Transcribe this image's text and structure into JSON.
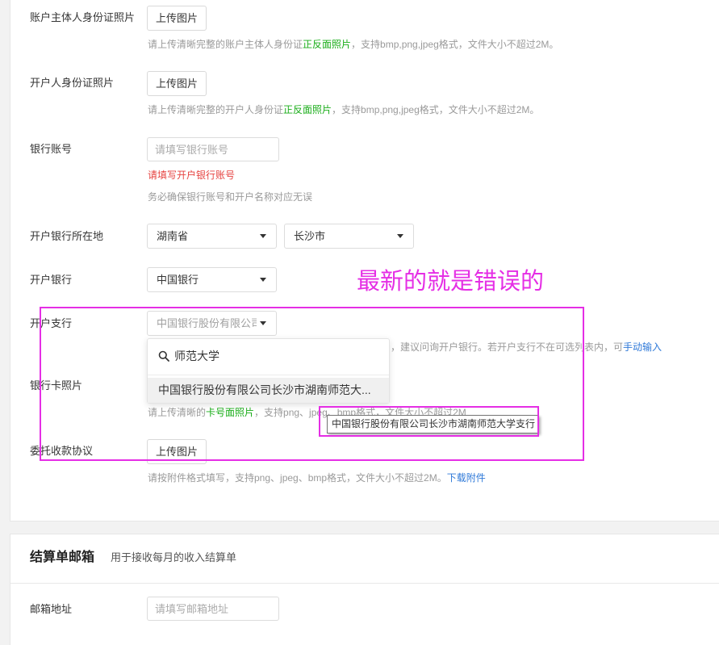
{
  "colors": {
    "page_bg": "#f2f2f2",
    "card_bg": "#ffffff",
    "border": "#e6e6e6",
    "text": "#353535",
    "hint": "#9a9a9a",
    "green": "#1aad19",
    "error": "#e64340",
    "link": "#2f79d8",
    "annotation": "#e52ee5"
  },
  "icons": {
    "search": "search-icon",
    "select_arrow": "caret-down-icon"
  },
  "form": {
    "owner_id_photo": {
      "label": "账户主体人身份证照片",
      "button": "上传图片",
      "hint_before": "请上传清晰完整的账户主体人身份证",
      "hint_highlight": "正反面照片",
      "hint_after": "，支持bmp,png,jpeg格式，文件大小不超过2M。"
    },
    "opener_id_photo": {
      "label": "开户人身份证照片",
      "button": "上传图片",
      "hint_before": "请上传清晰完整的开户人身份证",
      "hint_highlight": "正反面照片",
      "hint_after": "，支持bmp,png,jpeg格式，文件大小不超过2M。"
    },
    "bank_account": {
      "label": "银行账号",
      "placeholder": "请填写银行账号",
      "error": "请填写开户银行账号",
      "note": "务必确保银行账号和开户名称对应无误"
    },
    "bank_location": {
      "label": "开户银行所在地",
      "province": "湖南省",
      "city": "长沙市"
    },
    "bank": {
      "label": "开户银行",
      "value": "中国银行"
    },
    "branch": {
      "label": "开户支行",
      "value": "中国银行股份有限公司",
      "hint_visible": "，建议问询开户银行。若开户支行不在可选列表内，可",
      "hint_link": "手动输入",
      "dropdown": {
        "search_value": "师范大学",
        "options": [
          "中国银行股份有限公司长沙市湖南师范大..."
        ]
      },
      "tooltip": "中国银行股份有限公司长沙市湖南师范大学支行"
    },
    "card_photo": {
      "label": "银行卡照片",
      "hint_before": "请上传清晰的",
      "hint_highlight": "卡号面照片",
      "hint_after": "，支持png、jpeg、bmp格式，文件大小不超过2M"
    },
    "agreement": {
      "label": "委托收款协议",
      "button": "上传图片",
      "hint": "请按附件格式填写，支持png、jpeg、bmp格式，文件大小不超过2M。",
      "hint_link": "下载附件"
    }
  },
  "annotation": {
    "text": "最新的就是错误的"
  },
  "statement_email": {
    "title": "结算单邮箱",
    "subtitle": "用于接收每月的收入结算单",
    "field_label": "邮箱地址",
    "placeholder": "请填写邮箱地址"
  }
}
